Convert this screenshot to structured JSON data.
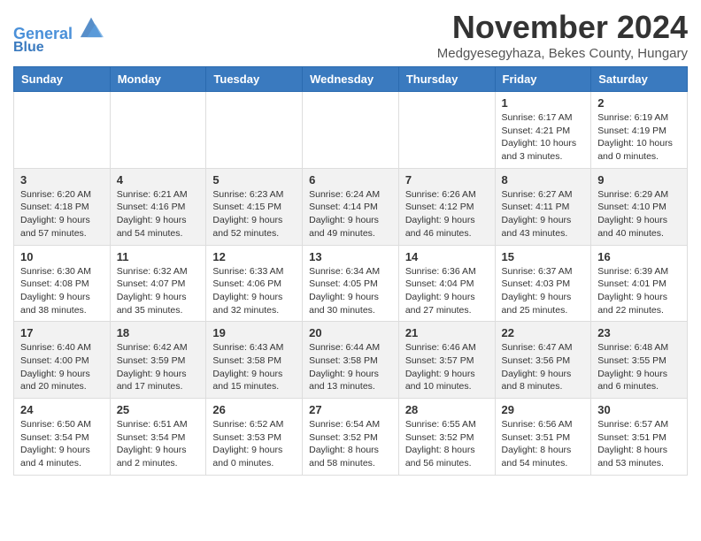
{
  "header": {
    "logo_line1": "General",
    "logo_line2": "Blue",
    "month_title": "November 2024",
    "subtitle": "Medgyesegyhaza, Bekes County, Hungary"
  },
  "days_of_week": [
    "Sunday",
    "Monday",
    "Tuesday",
    "Wednesday",
    "Thursday",
    "Friday",
    "Saturday"
  ],
  "weeks": [
    [
      {
        "day": "",
        "info": ""
      },
      {
        "day": "",
        "info": ""
      },
      {
        "day": "",
        "info": ""
      },
      {
        "day": "",
        "info": ""
      },
      {
        "day": "",
        "info": ""
      },
      {
        "day": "1",
        "info": "Sunrise: 6:17 AM\nSunset: 4:21 PM\nDaylight: 10 hours and 3 minutes."
      },
      {
        "day": "2",
        "info": "Sunrise: 6:19 AM\nSunset: 4:19 PM\nDaylight: 10 hours and 0 minutes."
      }
    ],
    [
      {
        "day": "3",
        "info": "Sunrise: 6:20 AM\nSunset: 4:18 PM\nDaylight: 9 hours and 57 minutes."
      },
      {
        "day": "4",
        "info": "Sunrise: 6:21 AM\nSunset: 4:16 PM\nDaylight: 9 hours and 54 minutes."
      },
      {
        "day": "5",
        "info": "Sunrise: 6:23 AM\nSunset: 4:15 PM\nDaylight: 9 hours and 52 minutes."
      },
      {
        "day": "6",
        "info": "Sunrise: 6:24 AM\nSunset: 4:14 PM\nDaylight: 9 hours and 49 minutes."
      },
      {
        "day": "7",
        "info": "Sunrise: 6:26 AM\nSunset: 4:12 PM\nDaylight: 9 hours and 46 minutes."
      },
      {
        "day": "8",
        "info": "Sunrise: 6:27 AM\nSunset: 4:11 PM\nDaylight: 9 hours and 43 minutes."
      },
      {
        "day": "9",
        "info": "Sunrise: 6:29 AM\nSunset: 4:10 PM\nDaylight: 9 hours and 40 minutes."
      }
    ],
    [
      {
        "day": "10",
        "info": "Sunrise: 6:30 AM\nSunset: 4:08 PM\nDaylight: 9 hours and 38 minutes."
      },
      {
        "day": "11",
        "info": "Sunrise: 6:32 AM\nSunset: 4:07 PM\nDaylight: 9 hours and 35 minutes."
      },
      {
        "day": "12",
        "info": "Sunrise: 6:33 AM\nSunset: 4:06 PM\nDaylight: 9 hours and 32 minutes."
      },
      {
        "day": "13",
        "info": "Sunrise: 6:34 AM\nSunset: 4:05 PM\nDaylight: 9 hours and 30 minutes."
      },
      {
        "day": "14",
        "info": "Sunrise: 6:36 AM\nSunset: 4:04 PM\nDaylight: 9 hours and 27 minutes."
      },
      {
        "day": "15",
        "info": "Sunrise: 6:37 AM\nSunset: 4:03 PM\nDaylight: 9 hours and 25 minutes."
      },
      {
        "day": "16",
        "info": "Sunrise: 6:39 AM\nSunset: 4:01 PM\nDaylight: 9 hours and 22 minutes."
      }
    ],
    [
      {
        "day": "17",
        "info": "Sunrise: 6:40 AM\nSunset: 4:00 PM\nDaylight: 9 hours and 20 minutes."
      },
      {
        "day": "18",
        "info": "Sunrise: 6:42 AM\nSunset: 3:59 PM\nDaylight: 9 hours and 17 minutes."
      },
      {
        "day": "19",
        "info": "Sunrise: 6:43 AM\nSunset: 3:58 PM\nDaylight: 9 hours and 15 minutes."
      },
      {
        "day": "20",
        "info": "Sunrise: 6:44 AM\nSunset: 3:58 PM\nDaylight: 9 hours and 13 minutes."
      },
      {
        "day": "21",
        "info": "Sunrise: 6:46 AM\nSunset: 3:57 PM\nDaylight: 9 hours and 10 minutes."
      },
      {
        "day": "22",
        "info": "Sunrise: 6:47 AM\nSunset: 3:56 PM\nDaylight: 9 hours and 8 minutes."
      },
      {
        "day": "23",
        "info": "Sunrise: 6:48 AM\nSunset: 3:55 PM\nDaylight: 9 hours and 6 minutes."
      }
    ],
    [
      {
        "day": "24",
        "info": "Sunrise: 6:50 AM\nSunset: 3:54 PM\nDaylight: 9 hours and 4 minutes."
      },
      {
        "day": "25",
        "info": "Sunrise: 6:51 AM\nSunset: 3:54 PM\nDaylight: 9 hours and 2 minutes."
      },
      {
        "day": "26",
        "info": "Sunrise: 6:52 AM\nSunset: 3:53 PM\nDaylight: 9 hours and 0 minutes."
      },
      {
        "day": "27",
        "info": "Sunrise: 6:54 AM\nSunset: 3:52 PM\nDaylight: 8 hours and 58 minutes."
      },
      {
        "day": "28",
        "info": "Sunrise: 6:55 AM\nSunset: 3:52 PM\nDaylight: 8 hours and 56 minutes."
      },
      {
        "day": "29",
        "info": "Sunrise: 6:56 AM\nSunset: 3:51 PM\nDaylight: 8 hours and 54 minutes."
      },
      {
        "day": "30",
        "info": "Sunrise: 6:57 AM\nSunset: 3:51 PM\nDaylight: 8 hours and 53 minutes."
      }
    ]
  ]
}
